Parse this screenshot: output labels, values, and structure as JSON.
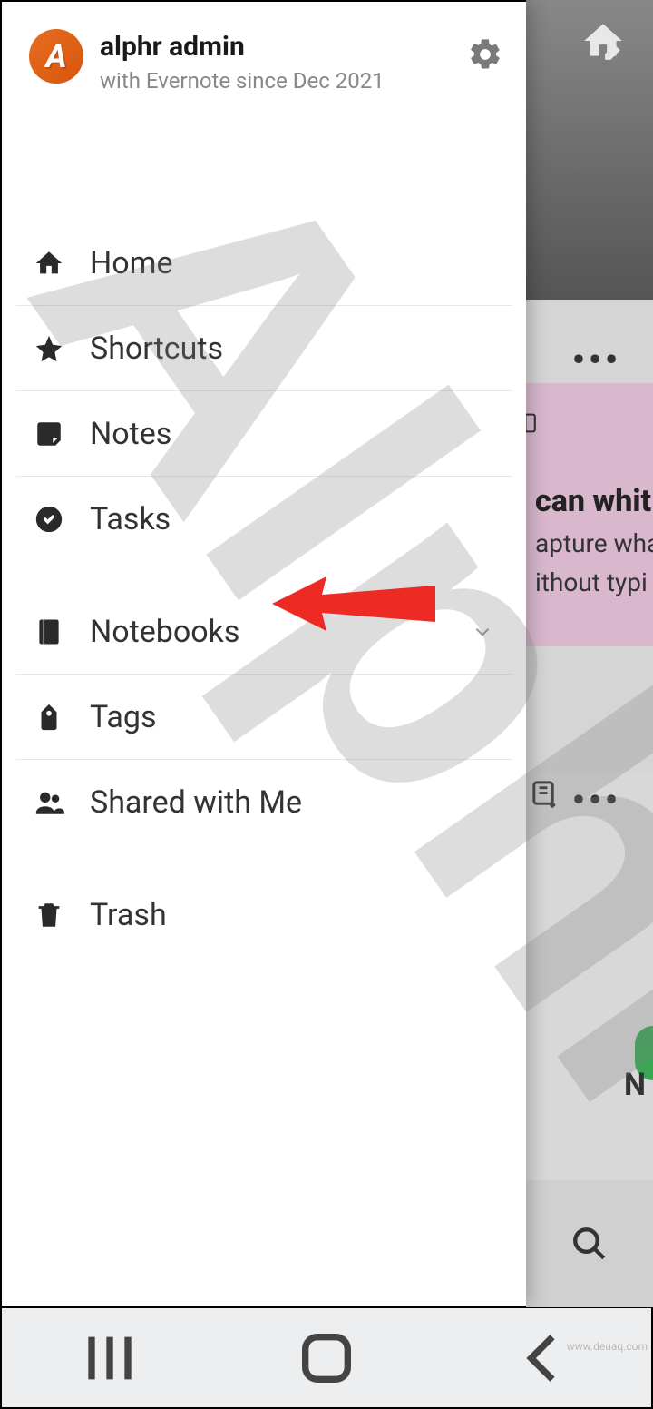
{
  "user": {
    "name": "alphr admin",
    "sub": "with Evernote since Dec 2021",
    "avatar_initial": "A"
  },
  "nav": {
    "home": "Home",
    "shortcuts": "Shortcuts",
    "notes": "Notes",
    "tasks": "Tasks",
    "notebooks": "Notebooks",
    "tags": "Tags",
    "shared": "Shared with Me",
    "trash": "Trash"
  },
  "background": {
    "card_title": "can whit",
    "card_text1": "apture wha",
    "card_text2": "ithout typi",
    "n_label": "N"
  },
  "url_watermark": "www.deuaq.com"
}
